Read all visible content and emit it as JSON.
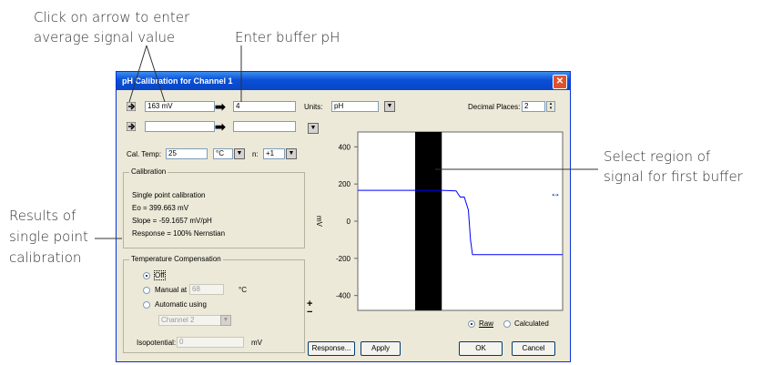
{
  "annotations": {
    "arrow_line1": "Click on arrow to enter",
    "arrow_line2": "average signal value",
    "enter_ph": "Enter buffer pH",
    "select_line1": "Select region of",
    "select_line2": "signal for first buffer",
    "results_line1": "Results of",
    "results_line2": "single point",
    "results_line3": "calibration"
  },
  "dialog": {
    "title": "pH Calibration for Channel 1",
    "close": "✕",
    "row1": {
      "signal_value": "163 mV",
      "buffer_ph": "4"
    },
    "row2": {
      "signal_value": "",
      "buffer_ph": ""
    },
    "units_label": "Units:",
    "units_value": "pH",
    "decimal_label": "Decimal Places:",
    "decimal_value": "2",
    "cal_temp_label": "Cal. Temp:",
    "cal_temp_value": "25",
    "cal_temp_unit": "°C",
    "n_label": "n:",
    "n_value": "+1",
    "calibration": {
      "title": "Calibration",
      "line1": "Single point calibration",
      "line2": "Eo = 399.663 mV",
      "line3": "Slope = -59.1657 mV/pH",
      "line4": "Response = 100% Nernstian"
    },
    "temp_comp": {
      "title": "Temperature Compensation",
      "off_label": "Off",
      "manual_label": "Manual at",
      "manual_value": "68",
      "manual_unit": "°C",
      "auto_label": "Automatic using",
      "channel_value": "Channel 2",
      "iso_label": "Isopotential:",
      "iso_value": "0",
      "iso_unit": "mV"
    },
    "raw_label": "Raw",
    "calc_label": "Calculated",
    "buttons": {
      "response": "Response...",
      "apply": "Apply",
      "ok": "OK",
      "cancel": "Cancel"
    },
    "zoom_plus": "+",
    "zoom_minus": "−",
    "move_icon_glyph": "↔"
  },
  "chart_data": {
    "type": "line",
    "ylabel": "mV",
    "yticks": [
      400,
      200,
      0,
      -200,
      -400
    ],
    "ylim": [
      -480,
      480
    ],
    "xlim": [
      0,
      100
    ],
    "selection_region": [
      28,
      41
    ],
    "series": [
      {
        "color": "#0000ff",
        "x": [
          0,
          28,
          41,
          48,
          50,
          52,
          54,
          55,
          56,
          57,
          58,
          100
        ],
        "y": [
          166,
          166,
          166,
          163,
          130,
          130,
          60,
          -100,
          -180,
          -180,
          -180,
          -180
        ]
      }
    ]
  }
}
